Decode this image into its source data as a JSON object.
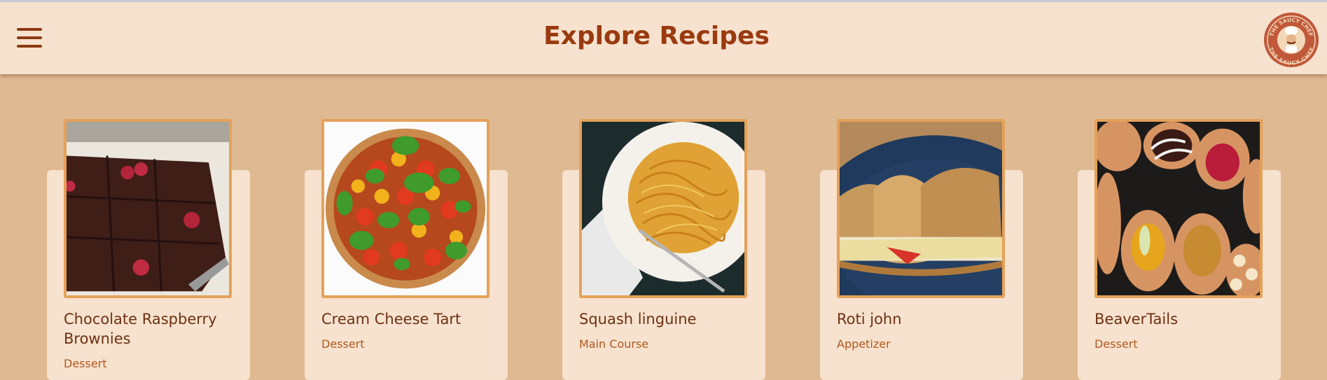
{
  "header": {
    "title": "Explore Recipes",
    "menu_icon": "hamburger-menu-icon",
    "logo": {
      "icon": "chef-logo",
      "text": "THE SAUCY CHEF"
    }
  },
  "recipes": [
    {
      "title": "Chocolate Raspberry Brownies",
      "category": "Dessert"
    },
    {
      "title": "Cream Cheese Tart",
      "category": "Dessert"
    },
    {
      "title": "Squash linguine",
      "category": "Main Course"
    },
    {
      "title": "Roti john",
      "category": "Appetizer"
    },
    {
      "title": "BeaverTails",
      "category": "Dessert"
    }
  ],
  "colors": {
    "page_bg": "#dfb991",
    "header_bg": "#f6e2ce",
    "title": "#9a3a10",
    "card_bg": "#f6e2ce",
    "image_border": "#e5a15a",
    "category": "#b0581f"
  }
}
